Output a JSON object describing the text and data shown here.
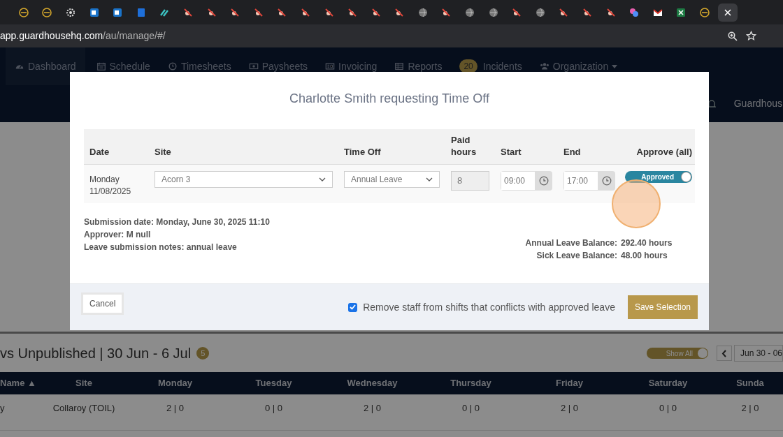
{
  "browser": {
    "url_host": "app.guardhousehq.com",
    "url_path": "/au/manage/#/"
  },
  "nav": {
    "items": [
      {
        "label": "Dashboard",
        "selected": true
      },
      {
        "label": "Schedule",
        "selected": false
      },
      {
        "label": "Timesheets",
        "selected": false
      },
      {
        "label": "Paysheets",
        "selected": false
      },
      {
        "label": "Invoicing",
        "selected": false
      },
      {
        "label": "Reports",
        "selected": false
      },
      {
        "label": "Incidents",
        "selected": false,
        "badge": "20"
      },
      {
        "label": "Organization",
        "selected": false
      }
    ],
    "account": "Guardhous"
  },
  "background": {
    "heading": "vs Unpublished | 30 Jun - 6 Jul",
    "badge": "5",
    "show_all": "Show All",
    "date_range": "Jun 30 - 06",
    "table": {
      "columns": [
        "Name ▲",
        "Site",
        "Monday",
        "Tuesday",
        "Wednesday",
        "Thursday",
        "Friday",
        "Saturday",
        "Sunda"
      ],
      "rows": [
        {
          "cells": [
            "y",
            "Collaroy (TOIL)",
            "2 | 0",
            "0 | 0",
            "2 | 0",
            "0 | 0",
            "2 | 0",
            "0 | 0",
            "2 | 0"
          ]
        }
      ]
    }
  },
  "modal": {
    "title": "Charlotte Smith requesting Time Off",
    "table": {
      "columns": [
        "Date",
        "Site",
        "Time Off",
        "Paid hours",
        "Start",
        "End",
        "Approve (all)"
      ],
      "rows": [
        {
          "date": "Monday 11/08/2025",
          "site": "Acorn 3",
          "time_off": "Annual Leave",
          "paid_hours": "8",
          "start": "09:00",
          "end": "17:00",
          "approval": {
            "label": "Approved",
            "on": true
          }
        }
      ]
    },
    "info": [
      "Submission date: Monday, June 30, 2025 11:10",
      "Approver: M null",
      "Leave submission notes: annual leave"
    ],
    "balances": [
      {
        "label": "Annual Leave Balance:",
        "value": "292.40 hours"
      },
      {
        "label": "Sick Leave Balance:",
        "value": "48.00 hours"
      }
    ],
    "cancel": "Cancel",
    "remove_option": {
      "label": "Remove staff from shifts that conflicts with approved leave",
      "checked": true
    },
    "save": "Save Selection"
  }
}
